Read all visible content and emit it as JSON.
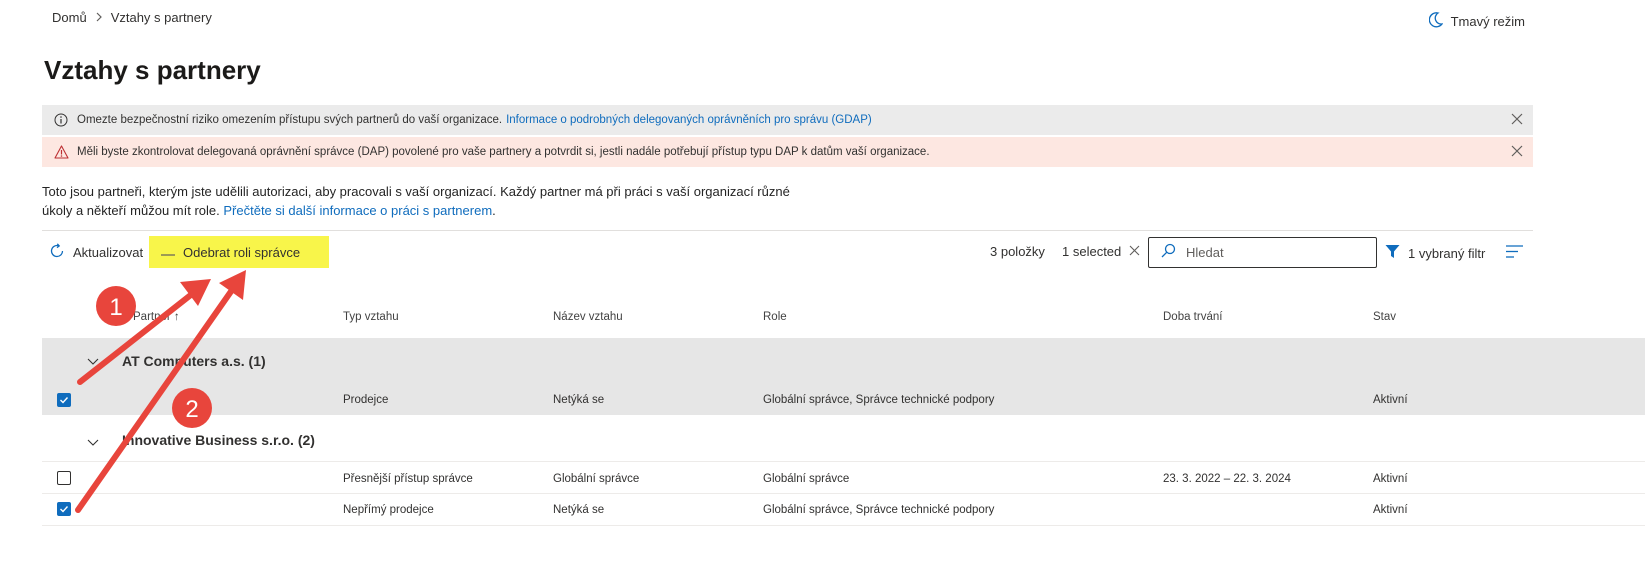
{
  "breadcrumb": {
    "home": "Domů",
    "current": "Vztahy s partnery"
  },
  "theme_toggle": {
    "label": "Tmavý režim",
    "icon": "moon-icon"
  },
  "page": {
    "title": "Vztahy s partnery"
  },
  "banners": {
    "info": {
      "icon": "info-icon",
      "text": "Omezte bezpečnostní riziko omezením přístupu svých partnerů do vaší organizace.",
      "link": "Informace o podrobných delegovaných oprávněních pro správu (GDAP)"
    },
    "warning": {
      "icon": "warning-icon",
      "text": "Měli byste zkontrolovat delegovaná oprávnění správce (DAP) povolené pro vaše partnery a potvrdit si, jestli nadále potřebují přístup typu DAP k datům vaší organizace."
    }
  },
  "description": {
    "text": "Toto jsou partneři, kterým jste udělili autorizaci, aby pracovali s vaší organizací. Každý partner má při práci s vaší organizací různé úkoly a někteří můžou mít role.",
    "link": "Přečtěte si další informace o práci s partnerem",
    "suffix": "."
  },
  "toolbar": {
    "refresh_label": "Aktualizovat",
    "remove_role_label": "Odebrat roli správce",
    "items_count": "3 položky",
    "selected_label": "1 selected",
    "search_placeholder": "Hledat",
    "filter_label": "1 vybraný filtr"
  },
  "table": {
    "columns": {
      "partner": "Partner ↑",
      "type": "Typ vztahu",
      "name": "Název vztahu",
      "roles": "Role",
      "duration": "Doba trvání",
      "status": "Stav"
    },
    "groups": [
      {
        "name": "AT Computers a.s. (1)",
        "rows": [
          {
            "checked": true,
            "type": "Prodejce",
            "name": "Netýká se",
            "roles": "Globální správce, Správce technické podpory",
            "duration": "",
            "status": "Aktivní"
          }
        ]
      },
      {
        "name": "Innovative Business s.r.o. (2)",
        "rows": [
          {
            "checked": false,
            "type": "Přesnější přístup správce",
            "name": "Globální správce",
            "roles": "Globální správce",
            "duration": "23. 3. 2022 – 22. 3. 2024",
            "status": "Aktivní"
          },
          {
            "checked": true,
            "type": "Nepřímý prodejce",
            "name": "Netýká se",
            "roles": "Globální správce, Správce technické podpory",
            "duration": "",
            "status": "Aktivní"
          }
        ]
      }
    ]
  },
  "annotations": [
    {
      "label": "1"
    },
    {
      "label": "2"
    }
  ],
  "colors": {
    "accent": "#0f6cbd",
    "highlight": "#f8f54a",
    "annotation": "#e8453c",
    "info_banner": "#ebebeb",
    "warning_banner": "#fde7e1",
    "selected_row": "#e6e6e6"
  }
}
